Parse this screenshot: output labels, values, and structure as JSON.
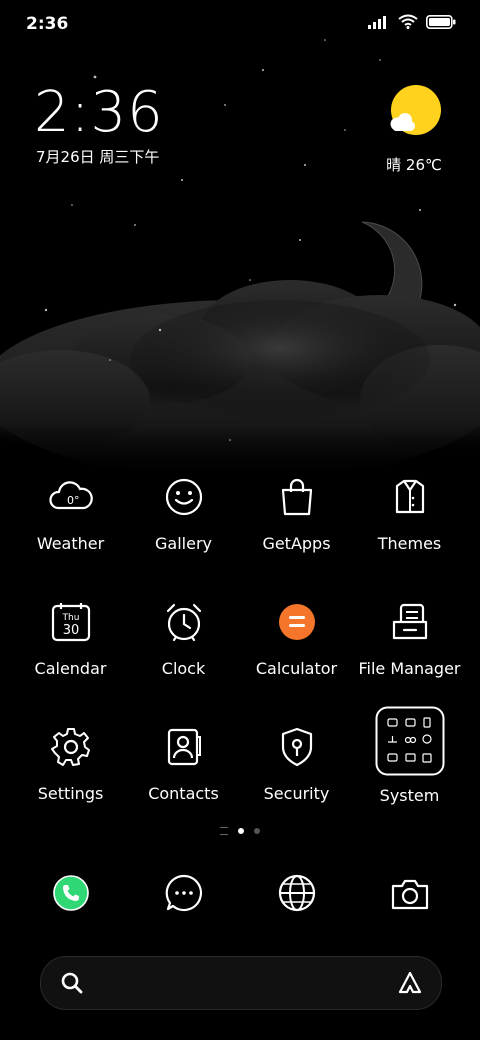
{
  "status_bar": {
    "time": "2:36"
  },
  "widget": {
    "clock": "2:36",
    "date": "7月26日 周三下午",
    "weather": "晴 26℃",
    "sun_color": "#FFD21E"
  },
  "apps": [
    {
      "label": "Weather",
      "icon": "weather-icon",
      "badge": "0°"
    },
    {
      "label": "Gallery",
      "icon": "gallery-icon"
    },
    {
      "label": "GetApps",
      "icon": "getapps-icon"
    },
    {
      "label": "Themes",
      "icon": "themes-icon"
    },
    {
      "label": "Calendar",
      "icon": "calendar-icon",
      "day_name": "Thu",
      "day_num": "30"
    },
    {
      "label": "Clock",
      "icon": "clock-icon"
    },
    {
      "label": "Calculator",
      "icon": "calculator-icon",
      "color": "#F5762A"
    },
    {
      "label": "File Manager",
      "icon": "file-manager-icon"
    },
    {
      "label": "Settings",
      "icon": "settings-icon"
    },
    {
      "label": "Contacts",
      "icon": "contacts-icon"
    },
    {
      "label": "Security",
      "icon": "security-icon"
    },
    {
      "label": "System",
      "icon": "system-folder-icon"
    }
  ],
  "dock": [
    {
      "icon": "phone-icon",
      "color": "#2FD874"
    },
    {
      "icon": "messages-icon"
    },
    {
      "icon": "browser-icon"
    },
    {
      "icon": "camera-icon"
    }
  ],
  "pager": {
    "pages": 2,
    "current": 1
  }
}
